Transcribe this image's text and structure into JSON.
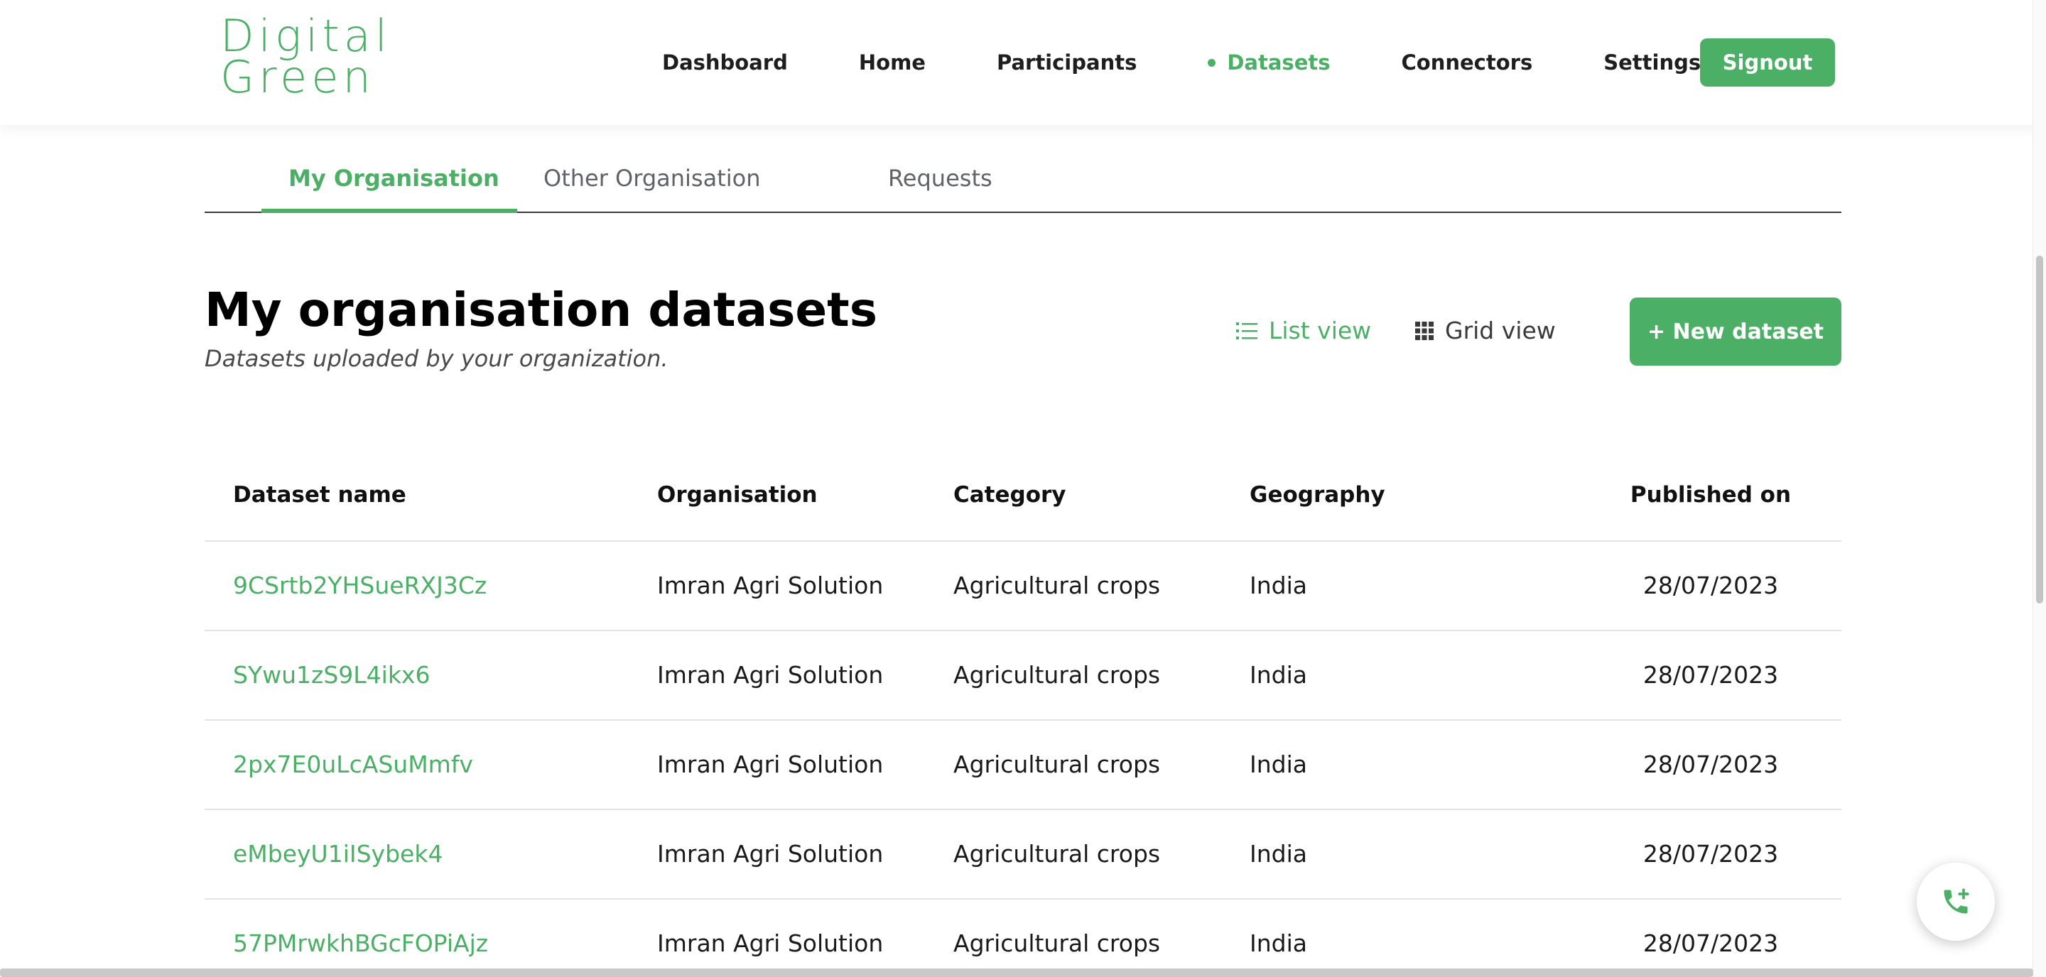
{
  "brand": {
    "logo_line1": "Digital",
    "logo_line2": "Green",
    "accent_color": "#4caf66"
  },
  "nav": {
    "items": [
      {
        "label": "Dashboard",
        "active": false
      },
      {
        "label": "Home",
        "active": false
      },
      {
        "label": "Participants",
        "active": false
      },
      {
        "label": "Datasets",
        "active": true
      },
      {
        "label": "Connectors",
        "active": false
      },
      {
        "label": "Settings",
        "active": false
      }
    ],
    "signout_label": "Signout"
  },
  "tabs": [
    {
      "label": "My Organisation",
      "active": true
    },
    {
      "label": "Other Organisation",
      "active": false
    },
    {
      "label": "Requests",
      "active": false
    }
  ],
  "main": {
    "title": "My organisation datasets",
    "subtitle": "Datasets uploaded by your organization.",
    "list_view_label": "List view",
    "grid_view_label": "Grid view",
    "new_dataset_label": "+ New dataset"
  },
  "table": {
    "headers": [
      "Dataset name",
      "Organisation",
      "Category",
      "Geography",
      "Published on"
    ],
    "rows": [
      {
        "name": "9CSrtb2YHSueRXJ3Cz",
        "organisation": "Imran Agri Solution",
        "category": "Agricultural crops",
        "geography": "India",
        "published": "28/07/2023"
      },
      {
        "name": "SYwu1zS9L4ikx6",
        "organisation": "Imran Agri Solution",
        "category": "Agricultural crops",
        "geography": "India",
        "published": "28/07/2023"
      },
      {
        "name": "2px7E0uLcASuMmfv",
        "organisation": "Imran Agri Solution",
        "category": "Agricultural crops",
        "geography": "India",
        "published": "28/07/2023"
      },
      {
        "name": "eMbeyU1iISybek4",
        "organisation": "Imran Agri Solution",
        "category": "Agricultural crops",
        "geography": "India",
        "published": "28/07/2023"
      },
      {
        "name": "57PMrwkhBGcFOPiAjz",
        "organisation": "Imran Agri Solution",
        "category": "Agricultural crops",
        "geography": "India",
        "published": "28/07/2023"
      }
    ]
  },
  "icons": {
    "list_view": "list-icon",
    "grid_view": "grid-icon",
    "call": "phone-add-icon"
  }
}
